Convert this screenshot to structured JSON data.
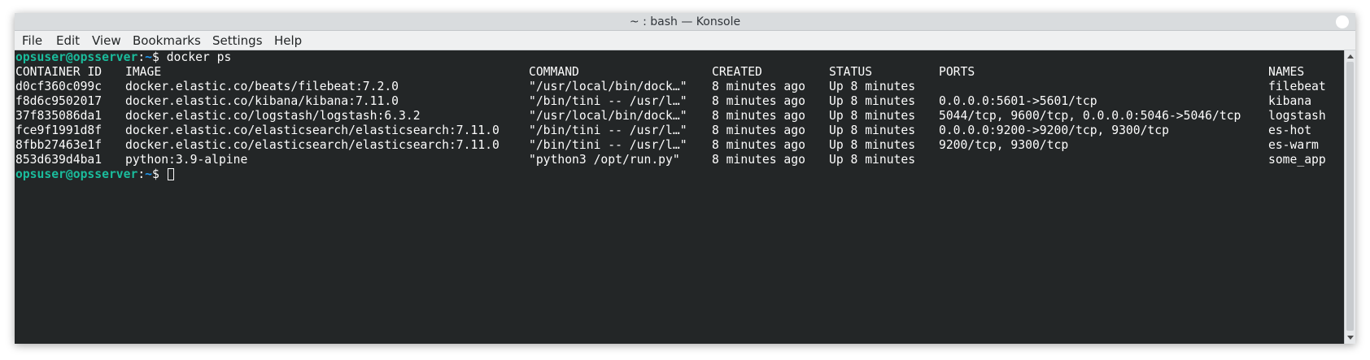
{
  "window": {
    "title": "~ : bash — Konsole"
  },
  "menu": [
    "File",
    "Edit",
    "View",
    "Bookmarks",
    "Settings",
    "Help"
  ],
  "terminal": {
    "prompt_user": "opsuser@opsserver",
    "prompt_sep": ":",
    "prompt_path": "~",
    "prompt_suffix": "$ ",
    "command": "docker ps",
    "headers": [
      "CONTAINER ID",
      "IMAGE",
      "COMMAND",
      "CREATED",
      "STATUS",
      "PORTS",
      "NAMES"
    ],
    "rows": [
      [
        "d0cf360c099c",
        "docker.elastic.co/beats/filebeat:7.2.0",
        "\"/usr/local/bin/dock…\"",
        "8 minutes ago",
        "Up 8 minutes",
        "",
        "filebeat"
      ],
      [
        "f8d6c9502017",
        "docker.elastic.co/kibana/kibana:7.11.0",
        "\"/bin/tini -- /usr/l…\"",
        "8 minutes ago",
        "Up 8 minutes",
        "0.0.0.0:5601->5601/tcp",
        "kibana"
      ],
      [
        "37f835086da1",
        "docker.elastic.co/logstash/logstash:6.3.2",
        "\"/usr/local/bin/dock…\"",
        "8 minutes ago",
        "Up 8 minutes",
        "5044/tcp, 9600/tcp, 0.0.0.0:5046->5046/tcp",
        "logstash"
      ],
      [
        "fce9f1991d8f",
        "docker.elastic.co/elasticsearch/elasticsearch:7.11.0",
        "\"/bin/tini -- /usr/l…\"",
        "8 minutes ago",
        "Up 8 minutes",
        "0.0.0.0:9200->9200/tcp, 9300/tcp",
        "es-hot"
      ],
      [
        "8fbb27463e1f",
        "docker.elastic.co/elasticsearch/elasticsearch:7.11.0",
        "\"/bin/tini -- /usr/l…\"",
        "8 minutes ago",
        "Up 8 minutes",
        "9200/tcp, 9300/tcp",
        "es-warm"
      ],
      [
        "853d639d4ba1",
        "python:3.9-alpine",
        "\"python3 /opt/run.py\"",
        "8 minutes ago",
        "Up 8 minutes",
        "",
        "some_app"
      ]
    ]
  },
  "colors": {
    "background": "#232627",
    "foreground": "#fcfcfc",
    "prompt_user": "#1abc9c",
    "prompt_path": "#1d99f3"
  }
}
